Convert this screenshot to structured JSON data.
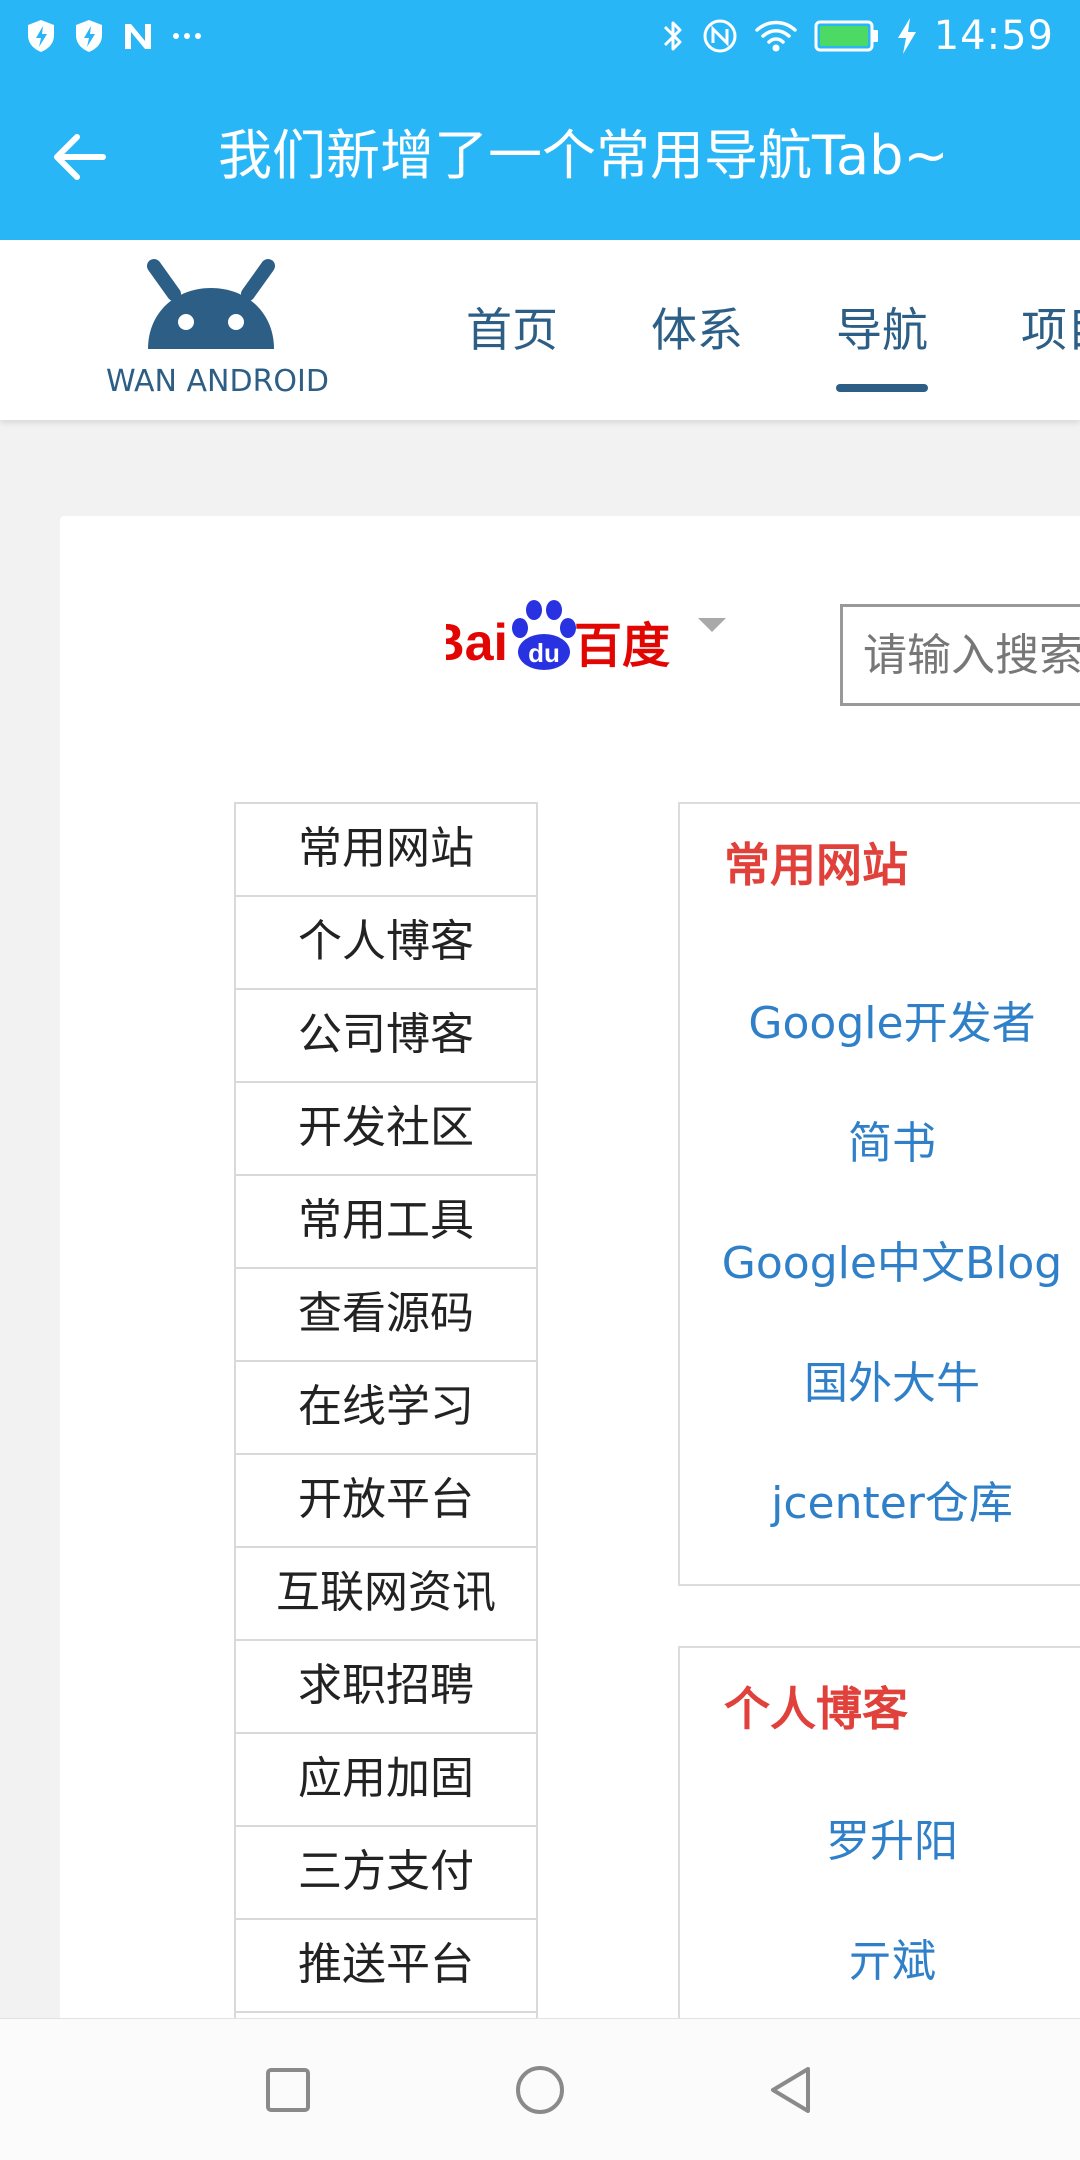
{
  "status_bar": {
    "time": "14:59",
    "notification_icons": [
      "shield-lightning-icon",
      "shield-lightning-icon",
      "n-logo-icon",
      "more-dots-icon"
    ],
    "system_icons": [
      "bluetooth-icon",
      "nfc-icon",
      "wifi-icon",
      "battery-icon",
      "charging-icon"
    ],
    "battery_level": 1.0,
    "battery_color": "#4cd964"
  },
  "toolbar": {
    "title": "我们新增了一个常用导航Tab~",
    "background": "#29b6f6",
    "back_icon": "arrow-left-icon"
  },
  "site": {
    "logo_text": "WAN ANDROID",
    "logo_color": "#2d5e86",
    "nav": [
      {
        "label": "首页",
        "active": false
      },
      {
        "label": "体系",
        "active": false
      },
      {
        "label": "导航",
        "active": true
      },
      {
        "label": "项目",
        "active": false
      }
    ]
  },
  "search": {
    "engine_logo_text": "Bai du 百度",
    "placeholder": "请输入搜索内容"
  },
  "categories": [
    "常用网站",
    "个人博客",
    "公司博客",
    "开发社区",
    "常用工具",
    "查看源码",
    "在线学习",
    "开放平台",
    "互联网资讯",
    "求职招聘",
    "应用加固",
    "三方支付",
    "推送平台"
  ],
  "panels": [
    {
      "title": "常用网站",
      "links": [
        "Google开发者",
        "简书",
        "Google中文Blog",
        "国外大牛",
        "jcenter仓库"
      ]
    },
    {
      "title": "个人博客",
      "links": [
        "罗升阳",
        "亓斌"
      ]
    }
  ],
  "colors": {
    "panel_title": "#e0413b",
    "link": "#2f80c9"
  },
  "system_nav": [
    "recents-square-icon",
    "home-circle-icon",
    "back-triangle-icon"
  ]
}
